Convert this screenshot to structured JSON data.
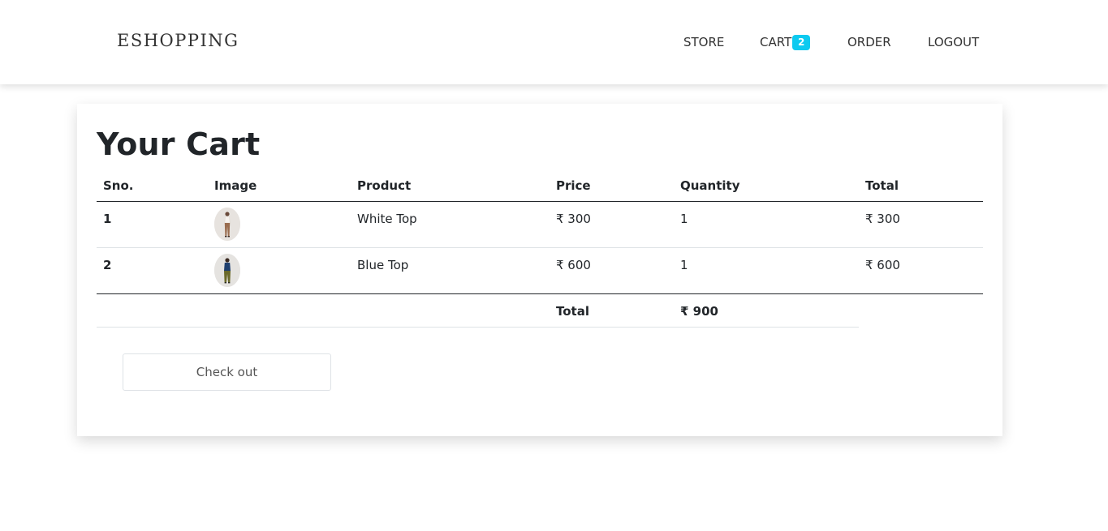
{
  "navbar": {
    "brand": "ESHOPPING",
    "links": {
      "store": "STORE",
      "cart": "CART",
      "cart_count": "2",
      "order": "ORDER",
      "logout": "LOGOUT"
    },
    "badge_color": "#0dcaf0"
  },
  "cart": {
    "title": "Your Cart",
    "columns": {
      "sno": "Sno.",
      "image": "Image",
      "product": "Product",
      "price": "Price",
      "quantity": "Quantity",
      "total": "Total"
    },
    "items": [
      {
        "sno": "1",
        "image_icon": "white-top-thumbnail",
        "product": "White Top",
        "price": "₹ 300",
        "quantity": "1",
        "total": "₹ 300"
      },
      {
        "sno": "2",
        "image_icon": "blue-top-thumbnail",
        "product": "Blue Top",
        "price": "₹ 600",
        "quantity": "1",
        "total": "₹ 600"
      }
    ],
    "summary": {
      "label": "Total",
      "value": "₹ 900"
    },
    "checkout_label": "Check out"
  }
}
